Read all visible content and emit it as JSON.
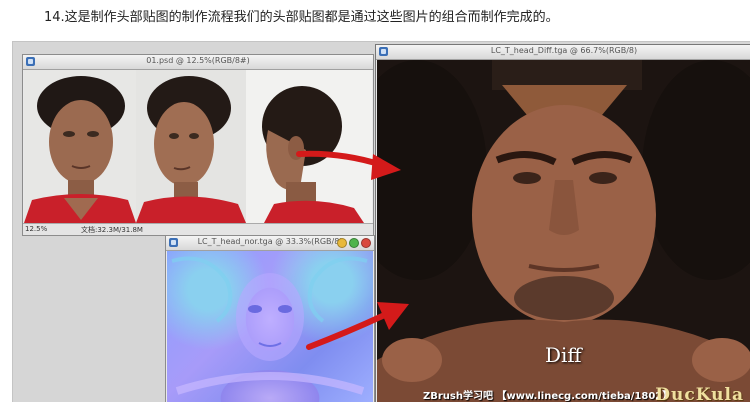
{
  "caption": {
    "text": "14.这是制作头部贴图的制作流程我们的头部贴图都是通过这些图片的组合而制作完成的。"
  },
  "windows": {
    "photo": {
      "title": "01.psd @ 12.5%(RGB/8#)",
      "zoom": "12.5%",
      "doc_size": "文档:32.3M/31.8M"
    },
    "normal": {
      "title": "LC_T_head_nor.tga @ 33.3%(RGB/8)"
    },
    "diff": {
      "title": "LC_T_head_Diff.tga @ 66.7%(RGB/8)",
      "label": "Diff"
    }
  },
  "watermark": {
    "text": "ZBrush学习吧 【www.linecg.com/tieba/1802】"
  },
  "logo": {
    "text": "DucKula"
  },
  "colors": {
    "arrow": "#d41a1a",
    "normal_map": "#9a94f5",
    "titlebar": "#dcdcdc",
    "stage_bg": "#d6d6d6"
  }
}
